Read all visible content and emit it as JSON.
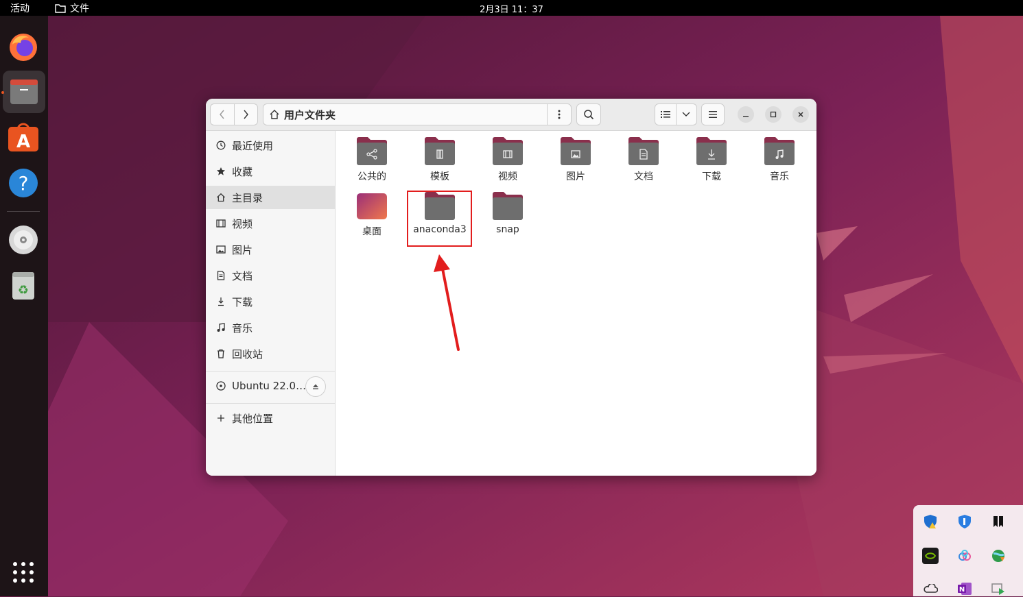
{
  "topbar": {
    "activities": "活动",
    "app_menu": "文件",
    "clock": "2月3日  11：37"
  },
  "dock": {
    "items": [
      "firefox-icon",
      "files-icon",
      "software-icon",
      "help-icon",
      "disc-icon",
      "trash-icon",
      "app-grid-icon"
    ]
  },
  "window": {
    "path_label": "用户文件夹"
  },
  "sidebar": {
    "items": [
      {
        "label": "最近使用",
        "icon": "clock-icon"
      },
      {
        "label": "收藏",
        "icon": "star-icon"
      },
      {
        "label": "主目录",
        "icon": "home-icon"
      },
      {
        "label": "视频",
        "icon": "film-icon"
      },
      {
        "label": "图片",
        "icon": "image-icon"
      },
      {
        "label": "文档",
        "icon": "document-icon"
      },
      {
        "label": "下载",
        "icon": "download-icon"
      },
      {
        "label": "音乐",
        "icon": "music-icon"
      },
      {
        "label": "回收站",
        "icon": "trash-icon"
      }
    ],
    "device": "Ubuntu 22.0…",
    "other": "其他位置"
  },
  "folders": [
    {
      "name": "公共的",
      "icon": "share-icon"
    },
    {
      "name": "模板",
      "icon": "template-icon"
    },
    {
      "name": "视频",
      "icon": "film-icon"
    },
    {
      "name": "图片",
      "icon": "image-icon"
    },
    {
      "name": "文档",
      "icon": "document-icon"
    },
    {
      "name": "下载",
      "icon": "download-icon"
    },
    {
      "name": "音乐",
      "icon": "music-icon"
    },
    {
      "name": "桌面",
      "icon": "desktop-folder-icon"
    },
    {
      "name": "anaconda3",
      "icon": "folder-icon"
    },
    {
      "name": "snap",
      "icon": "folder-icon"
    }
  ],
  "colors": {
    "accent": "#e95420",
    "folder_body": "#6e6e6e",
    "folder_tab": "#8a2f4c",
    "highlight": "#e21d1d"
  }
}
